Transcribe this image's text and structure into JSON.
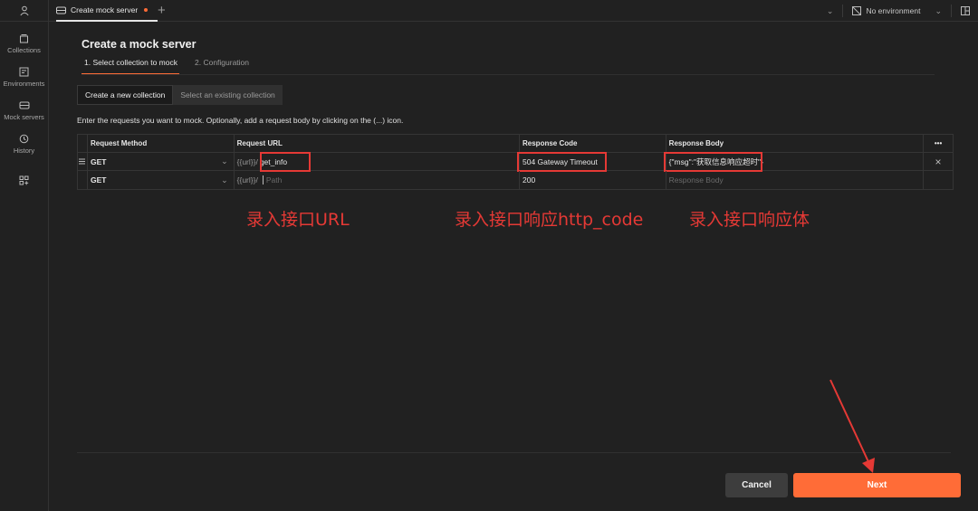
{
  "rail": {
    "items": [
      {
        "label": "Collections",
        "icon": "collections-icon"
      },
      {
        "label": "Environments",
        "icon": "environments-icon"
      },
      {
        "label": "Mock servers",
        "icon": "mock-servers-icon"
      },
      {
        "label": "History",
        "icon": "history-icon"
      }
    ]
  },
  "tabbar": {
    "tab_title": "Create mock server",
    "environment": "No environment"
  },
  "page": {
    "title": "Create a mock server",
    "step1": "1. Select collection to mock",
    "step2": "2. Configuration",
    "option_new": "Create a new collection",
    "option_existing": "Select an existing collection",
    "hint": "Enter the requests you want to mock. Optionally, add a request body by clicking on the (...) icon."
  },
  "table": {
    "headers": {
      "method": "Request Method",
      "url": "Request URL",
      "code": "Response Code",
      "body": "Response Body",
      "actions": "•••"
    },
    "rows": [
      {
        "method": "GET",
        "url_prefix": "{{url}}/",
        "url": "get_info",
        "code": "504 Gateway Timeout",
        "body": "{\"msg\":\"获取信息响应超时\"}"
      },
      {
        "method": "GET",
        "url_prefix": "{{url}}/",
        "url_placeholder": "Path",
        "code": "200",
        "body_placeholder": "Response Body"
      }
    ]
  },
  "annotations": {
    "url": "录入接口URL",
    "code": "录入接口响应http_code",
    "body": "录入接口响应体"
  },
  "buttons": {
    "cancel": "Cancel",
    "next": "Next"
  },
  "colors": {
    "accent": "#ff6c37",
    "annotation": "#e53935",
    "background": "#212121"
  }
}
